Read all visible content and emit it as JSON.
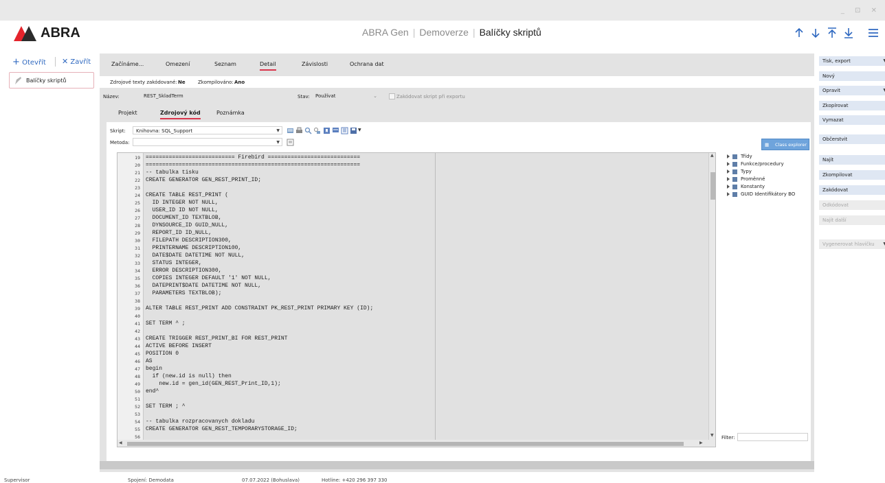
{
  "window": {
    "controls": "_ ⊡ ✕"
  },
  "header": {
    "logo_text": "ABRA",
    "app_name": "ABRA Gen",
    "edition": "Demoverze",
    "module": "Balíčky skriptů"
  },
  "left": {
    "open_label": "Otevřít",
    "close_label": "Zavřít",
    "item_label": "Balíčky skriptů"
  },
  "tabs": [
    "Začínáme...",
    "Omezení",
    "Seznam",
    "Detail",
    "Závislosti",
    "Ochrana dat"
  ],
  "info": {
    "encoded_label": "Zdrojové texty zakódované:",
    "encoded_value": "Ne",
    "compiled_label": "Zkompilováno:",
    "compiled_value": "Ano"
  },
  "form": {
    "name_label": "Název:",
    "name_value": "REST_SkladTerm",
    "state_label": "Stav:",
    "state_value": "Používat",
    "encode_export_label": "Zakódovat skript při exportu"
  },
  "subtabs": [
    "Projekt",
    "Zdrojový kód",
    "Poznámka"
  ],
  "toolbar": {
    "script_label": "Skript:",
    "script_value": "Knihovna: SQL_Support",
    "method_label": "Metoda:",
    "method_value": "",
    "class_explorer": "Class explorer"
  },
  "code_lines": [
    {
      "n": "19",
      "t": "=========================== Firebird ============================"
    },
    {
      "n": "20",
      "t": "================================================================="
    },
    {
      "n": "21",
      "t": "-- tabulka tisku"
    },
    {
      "n": "22",
      "t": "CREATE GENERATOR GEN_REST_PRINT_ID;"
    },
    {
      "n": "23",
      "t": ""
    },
    {
      "n": "24",
      "t": "CREATE TABLE REST_PRINT ("
    },
    {
      "n": "25",
      "t": "  ID INTEGER NOT NULL,"
    },
    {
      "n": "26",
      "t": "  USER_ID ID NOT NULL,"
    },
    {
      "n": "27",
      "t": "  DOCUMENT_ID TEXTBLOB,"
    },
    {
      "n": "28",
      "t": "  DYNSOURCE_ID GUID_NULL,"
    },
    {
      "n": "29",
      "t": "  REPORT_ID ID_NULL,"
    },
    {
      "n": "30",
      "t": "  FILEPATH DESCRIPTION300,"
    },
    {
      "n": "31",
      "t": "  PRINTERNAME DESCRIPTION100,"
    },
    {
      "n": "32",
      "t": "  DATE$DATE DATETIME NOT NULL,"
    },
    {
      "n": "33",
      "t": "  STATUS INTEGER,"
    },
    {
      "n": "34",
      "t": "  ERROR DESCRIPTION300,"
    },
    {
      "n": "35",
      "t": "  COPIES INTEGER DEFAULT '1' NOT NULL,"
    },
    {
      "n": "36",
      "t": "  DATEPRINT$DATE DATETIME NOT NULL,"
    },
    {
      "n": "37",
      "t": "  PARAMETERS TEXTBLOB);"
    },
    {
      "n": "38",
      "t": ""
    },
    {
      "n": "39",
      "t": "ALTER TABLE REST_PRINT ADD CONSTRAINT PK_REST_PRINT PRIMARY KEY (ID);"
    },
    {
      "n": "40",
      "t": ""
    },
    {
      "n": "41",
      "t": "SET TERM ^ ;"
    },
    {
      "n": "42",
      "t": ""
    },
    {
      "n": "43",
      "t": "CREATE TRIGGER REST_PRINT_BI FOR REST_PRINT"
    },
    {
      "n": "44",
      "t": "ACTIVE BEFORE INSERT"
    },
    {
      "n": "45",
      "t": "POSITION 0"
    },
    {
      "n": "46",
      "t": "AS"
    },
    {
      "n": "47",
      "t": "begin"
    },
    {
      "n": "48",
      "t": "  if (new.id is null) then"
    },
    {
      "n": "49",
      "t": "    new.id = gen_id(GEN_REST_Print_ID,1);"
    },
    {
      "n": "50",
      "t": "end^"
    },
    {
      "n": "51",
      "t": ""
    },
    {
      "n": "52",
      "t": "SET TERM ; ^"
    },
    {
      "n": "53",
      "t": ""
    },
    {
      "n": "54",
      "t": "-- tabulka rozpracovanych dokladu"
    },
    {
      "n": "55",
      "t": "CREATE GENERATOR GEN_REST_TEMPORARYSTORAGE_ID;"
    },
    {
      "n": "56",
      "t": ""
    }
  ],
  "tree": [
    "Třídy",
    "Funkce/procedury",
    "Typy",
    "Proměnné",
    "Konstanty",
    "GUID Identifikátory BO"
  ],
  "filter_label": "Filter:",
  "actions": [
    {
      "label": "Tisk, export",
      "enabled": true,
      "dropdown": true
    },
    {
      "label": "Nový",
      "enabled": true,
      "dropdown": false
    },
    {
      "label": "Opravit",
      "enabled": true,
      "dropdown": true
    },
    {
      "label": "Zkopírovat",
      "enabled": true,
      "dropdown": false
    },
    {
      "label": "Vymazat",
      "enabled": true,
      "dropdown": false
    },
    {
      "label": "Občerstvit",
      "enabled": true,
      "dropdown": false
    },
    {
      "label": "Najít",
      "enabled": true,
      "dropdown": false
    },
    {
      "label": "Zkompilovat",
      "enabled": true,
      "dropdown": false
    },
    {
      "label": "Zakódovat",
      "enabled": true,
      "dropdown": false
    },
    {
      "label": "Odkódovat",
      "enabled": false,
      "dropdown": false
    },
    {
      "label": "Najít další",
      "enabled": false,
      "dropdown": false
    },
    {
      "label": "Vygenerovat hlavičku",
      "enabled": false,
      "dropdown": true
    }
  ],
  "status": {
    "user": "Supervisor",
    "connection": "Spojení: Demodata",
    "date": "07.07.2022 (Bohuslava)",
    "hotline": "Hotline: +420 296 397 330"
  },
  "colors": {
    "accent": "#d9344b",
    "link": "#2e68c0",
    "logo_red": "#e4242c"
  }
}
